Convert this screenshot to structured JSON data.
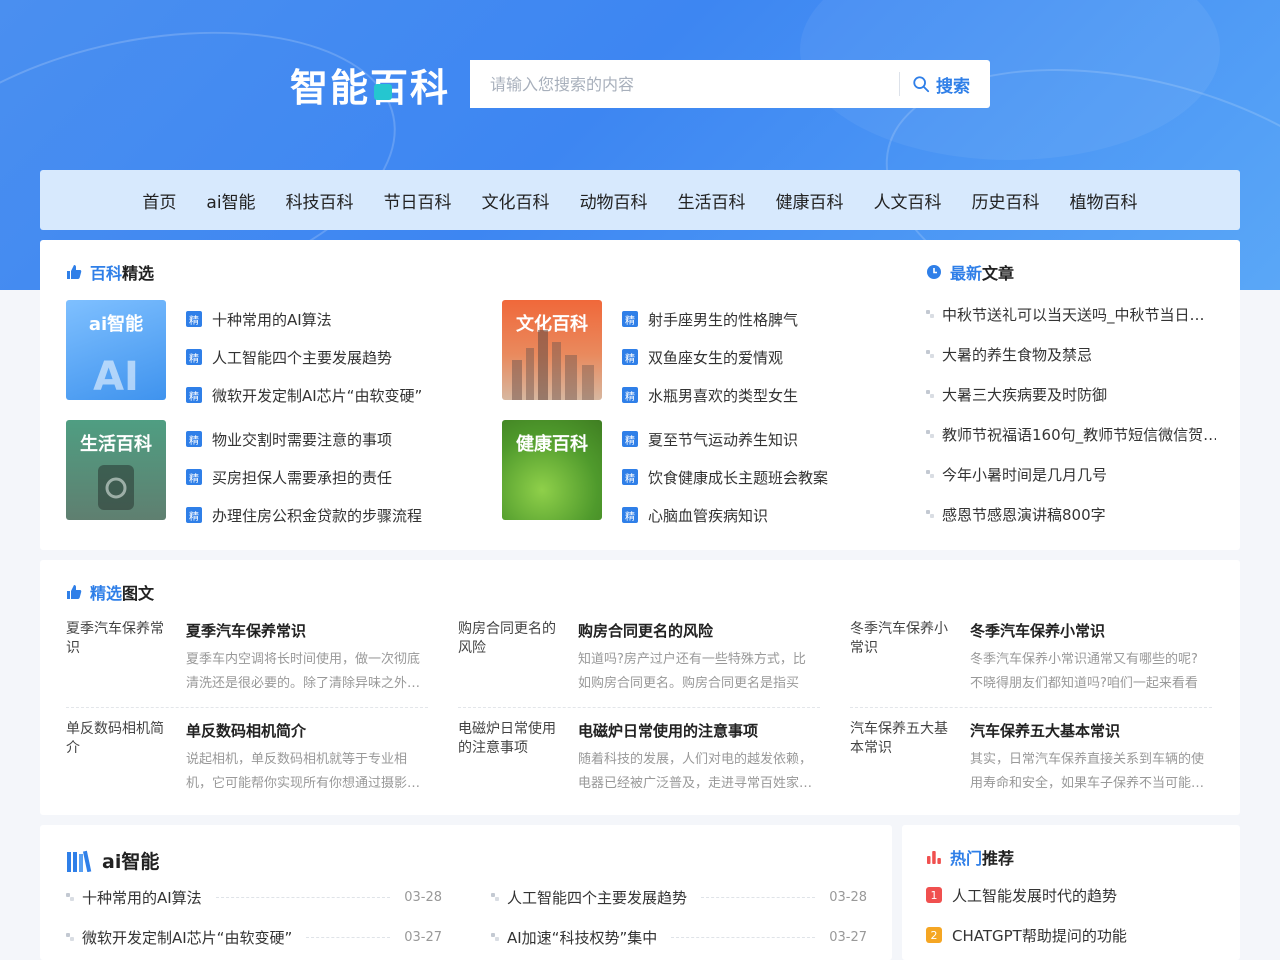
{
  "site": {
    "logo": "智能百科"
  },
  "search": {
    "placeholder": "请输入您搜索的内容",
    "button": "搜索"
  },
  "nav": [
    "首页",
    "ai智能",
    "科技百科",
    "节日百科",
    "文化百科",
    "动物百科",
    "生活百科",
    "健康百科",
    "人文百科",
    "历史百科",
    "植物百科"
  ],
  "featured": {
    "title_hl": "百科",
    "title_rest": "精选",
    "badge": "精",
    "blocks": [
      {
        "label": "ai智能",
        "items": [
          "十种常用的AI算法",
          "人工智能四个主要发展趋势",
          "微软开发定制AI芯片“由软变硬”"
        ]
      },
      {
        "label": "文化百科",
        "items": [
          "射手座男生的性格脾气",
          "双鱼座女生的爱情观",
          "水瓶男喜欢的类型女生"
        ]
      },
      {
        "label": "生活百科",
        "items": [
          "物业交割时需要注意的事项",
          "买房担保人需要承担的责任",
          "办理住房公积金贷款的步骤流程"
        ]
      },
      {
        "label": "健康百科",
        "items": [
          "夏至节气运动养生知识",
          "饮食健康成长主题班会教案",
          "心脑血管疾病知识"
        ]
      }
    ]
  },
  "latest": {
    "title_hl": "最新",
    "title_rest": "文章",
    "items": [
      "中秋节送礼可以当天送吗_中秋节当日…",
      "大暑的养生食物及禁忌",
      "大暑三大疾病要及时防御",
      "教师节祝福语160句_教师节短信微信贺…",
      "今年小暑时间是几月几号",
      "感恩节感恩演讲稿800字"
    ]
  },
  "picnews": {
    "title_hl": "精选",
    "title_rest": "图文",
    "items": [
      {
        "img_alt": "夏季汽车保养常识",
        "title": "夏季汽车保养常识",
        "desc": "夏季车内空调将长时间使用，做一次彻底清洗还是很必要的。除了清除异味之外…"
      },
      {
        "img_alt": "购房合同更名的风险",
        "title": "购房合同更名的风险",
        "desc": "知道吗?房产过户还有一些特殊方式，比如购房合同更名。购房合同更名是指买受…"
      },
      {
        "img_alt": "冬季汽车保养小常识",
        "title": "冬季汽车保养小常识",
        "desc": "冬季汽车保养小常识通常又有哪些的呢?不晓得朋友们都知道吗?咱们一起来看看以…"
      },
      {
        "img_alt": "单反数码相机简介",
        "title": "单反数码相机简介",
        "desc": "说起相机，单反数码相机就等于专业相机，它可能帮你实现所有你想通过摄影…"
      },
      {
        "img_alt": "电磁炉日常使用的注意事项",
        "title": "电磁炉日常使用的注意事项",
        "desc": "随着科技的发展，人们对电的越发依赖，电器已经被广泛普及，走进寻常百姓家…"
      },
      {
        "img_alt": "汽车保养五大基本常识",
        "title": "汽车保养五大基本常识",
        "desc": "其实，日常汽车保养直接关系到车辆的使用寿命和安全，如果车子保养不当可能…"
      }
    ]
  },
  "ai_section": {
    "title": "ai智能",
    "rows": [
      {
        "title": "十种常用的AI算法",
        "date": "03-28"
      },
      {
        "title": "人工智能四个主要发展趋势",
        "date": "03-28"
      },
      {
        "title": "微软开发定制AI芯片“由软变硬”",
        "date": "03-27"
      },
      {
        "title": "AI加速“科技权势”集中",
        "date": "03-27"
      }
    ]
  },
  "hot": {
    "title_hl": "热门",
    "title_rest": "推荐",
    "items": [
      {
        "rank": "1",
        "title": "人工智能发展时代的趋势"
      },
      {
        "rank": "2",
        "title": "CHATGPT帮助提问的功能"
      }
    ]
  },
  "colors": {
    "accent": "#2f7fe8",
    "rank1": "#f0504f",
    "rank2": "#f5a623"
  }
}
